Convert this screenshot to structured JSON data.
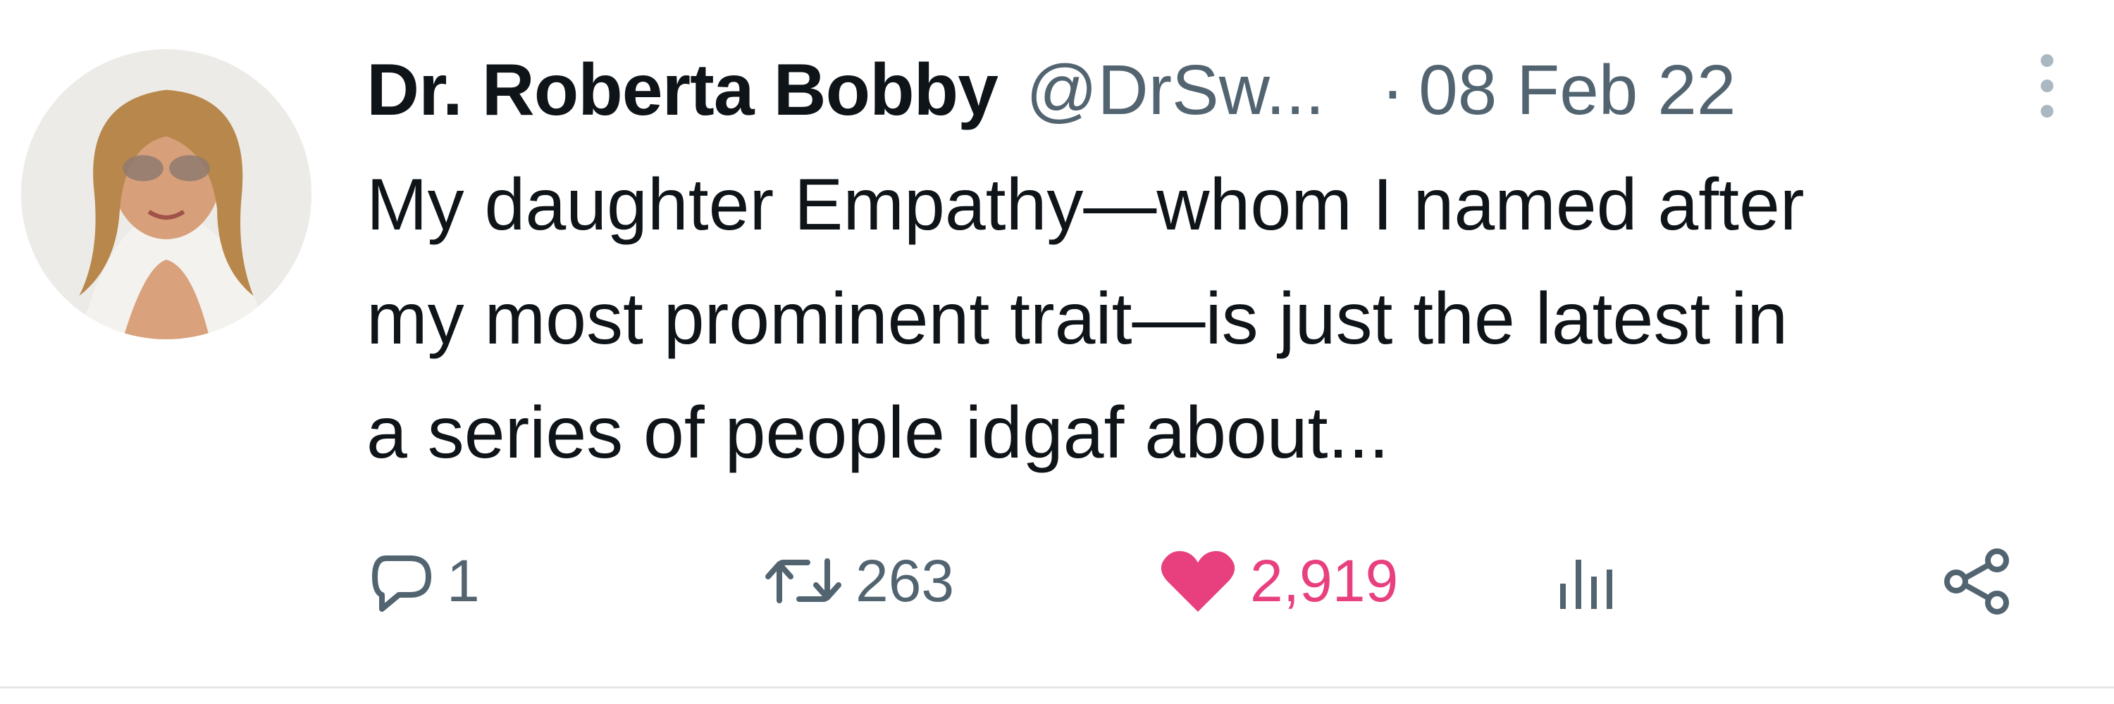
{
  "tweet": {
    "author_name": "Dr. Roberta Bobby",
    "author_handle": "@DrSw...",
    "separator": "·",
    "date": "08 Feb 22",
    "text_lines": [
      "My daughter Empathy—whom I named after",
      "my most prominent trait—is just the latest in",
      "a series of people idgaf about..."
    ],
    "actions": {
      "reply_count": "1",
      "retweet_count": "263",
      "like_count": "2,919"
    }
  },
  "colors": {
    "text_primary": "#0f1419",
    "text_secondary": "#536471",
    "like_active": "#e8407f"
  },
  "icons": {
    "more": "more-vertical-icon",
    "reply": "reply-icon",
    "retweet": "retweet-icon",
    "like": "heart-icon",
    "views": "views-icon",
    "share": "share-icon"
  }
}
